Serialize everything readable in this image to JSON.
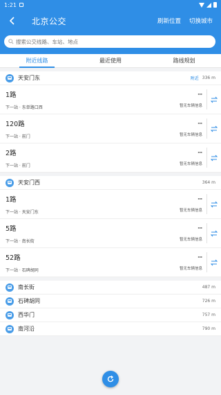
{
  "status": {
    "time": "1:21"
  },
  "header": {
    "title": "北京公交",
    "refresh_location": "刷新位置",
    "switch_city": "切换城市"
  },
  "search": {
    "placeholder": "搜索公交线路、车站、地点"
  },
  "tabs": [
    {
      "label": "附近线路",
      "active": true
    },
    {
      "label": "最近使用",
      "active": false
    },
    {
      "label": "路线规划",
      "active": false
    }
  ],
  "stations": [
    {
      "name": "天安门东",
      "tag": "附近",
      "distance": "336 m",
      "routes": [
        {
          "number": "1路",
          "next_stop": "下一站 · 东单路口西",
          "time": "--",
          "info": "暂无车辆信息"
        },
        {
          "number": "120路",
          "next_stop": "下一站 · 前门",
          "time": "--",
          "info": "暂无车辆信息"
        },
        {
          "number": "2路",
          "next_stop": "下一站 · 前门",
          "time": "--",
          "info": "暂无车辆信息"
        }
      ]
    },
    {
      "name": "天安门西",
      "tag": "",
      "distance": "364 m",
      "routes": [
        {
          "number": "1路",
          "next_stop": "下一站 · 天安门东",
          "time": "--",
          "info": "暂无车辆信息"
        },
        {
          "number": "5路",
          "next_stop": "下一站 · 南长街",
          "time": "--",
          "info": "暂无车辆信息"
        },
        {
          "number": "52路",
          "next_stop": "下一站 · 石碑胡同",
          "time": "--",
          "info": "暂无车辆信息"
        }
      ]
    }
  ],
  "other_stations": [
    {
      "name": "南长街",
      "distance": "487 m"
    },
    {
      "name": "石碑胡同",
      "distance": "726 m"
    },
    {
      "name": "西华门",
      "distance": "757 m"
    },
    {
      "name": "南河沿",
      "distance": "790 m"
    }
  ],
  "colors": {
    "primary": "#2f8ee6"
  },
  "icons": {
    "back": "arrow-left-icon",
    "search": "search-icon",
    "stop": "bus-icon",
    "swap": "swap-direction-icon",
    "refresh": "refresh-icon"
  }
}
